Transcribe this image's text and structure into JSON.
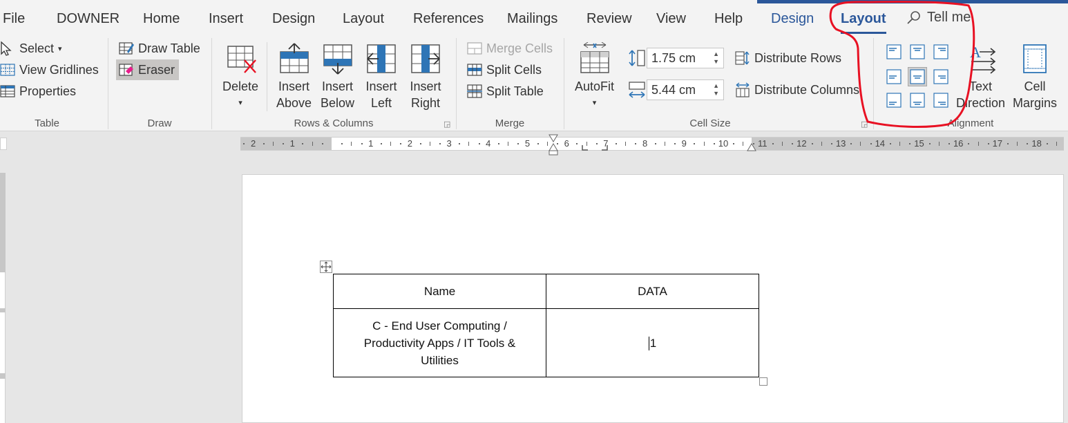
{
  "tabs": {
    "file": "File",
    "downer": "DOWNER",
    "home": "Home",
    "insert": "Insert",
    "design": "Design",
    "layout": "Layout",
    "references": "References",
    "mailings": "Mailings",
    "review": "Review",
    "view": "View",
    "help": "Help",
    "table_design": "Design",
    "table_layout": "Layout",
    "tell_me": "Tell me"
  },
  "ribbon": {
    "table": {
      "label": "Table",
      "select": "Select",
      "view_gridlines": "View Gridlines",
      "properties": "Properties"
    },
    "draw": {
      "label": "Draw",
      "draw_table": "Draw Table",
      "eraser": "Eraser"
    },
    "rows_columns": {
      "label": "Rows & Columns",
      "delete": "Delete",
      "insert_above_1": "Insert",
      "insert_above_2": "Above",
      "insert_below_1": "Insert",
      "insert_below_2": "Below",
      "insert_left_1": "Insert",
      "insert_left_2": "Left",
      "insert_right_1": "Insert",
      "insert_right_2": "Right"
    },
    "merge": {
      "label": "Merge",
      "merge_cells": "Merge Cells",
      "split_cells": "Split Cells",
      "split_table": "Split Table"
    },
    "cell_size": {
      "label": "Cell Size",
      "autofit": "AutoFit",
      "height": "1.75 cm",
      "width": "5.44 cm",
      "distribute_rows": "Distribute Rows",
      "distribute_columns": "Distribute Columns"
    },
    "alignment": {
      "label": "Alignment",
      "text_direction_1": "Text",
      "text_direction_2": "Direction",
      "cell_margins_1": "Cell",
      "cell_margins_2": "Margins"
    }
  },
  "ruler": {
    "numbers": [
      "2",
      "1",
      "1",
      "2",
      "3",
      "4",
      "5",
      "6",
      "7",
      "8",
      "9",
      "10",
      "11",
      "12",
      "13",
      "14",
      "15",
      "16",
      "17",
      "18"
    ]
  },
  "document": {
    "table": {
      "header": [
        "Name",
        "DATA"
      ],
      "rows": [
        [
          "C - End User Computing / Productivity Apps / IT Tools & Utilities",
          "1"
        ]
      ]
    }
  },
  "colors": {
    "accent": "#2b579a",
    "annotation": "#e81123",
    "delete_x": "#e81123",
    "icon_blue": "#2e75b6"
  }
}
